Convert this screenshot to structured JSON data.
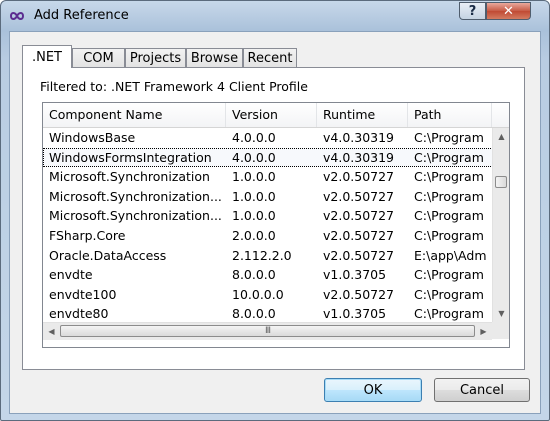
{
  "window": {
    "title": "Add Reference",
    "help_label": "?",
    "close_label": "✕"
  },
  "tabs": [
    {
      "label": ".NET",
      "active": true
    },
    {
      "label": "COM",
      "active": false
    },
    {
      "label": "Projects",
      "active": false
    },
    {
      "label": "Browse",
      "active": false
    },
    {
      "label": "Recent",
      "active": false
    }
  ],
  "filter_label": "Filtered to: .NET Framework 4 Client Profile",
  "columns": [
    "Component Name",
    "Version",
    "Runtime",
    "Path"
  ],
  "rows": [
    {
      "name": "WindowsBase",
      "version": "4.0.0.0",
      "runtime": "v4.0.30319",
      "path": "C:\\Program",
      "selected": false
    },
    {
      "name": "WindowsFormsIntegration",
      "version": "4.0.0.0",
      "runtime": "v4.0.30319",
      "path": "C:\\Program",
      "selected": true
    },
    {
      "name": "Microsoft.Synchronization",
      "version": "1.0.0.0",
      "runtime": "v2.0.50727",
      "path": "C:\\Program",
      "selected": false
    },
    {
      "name": "Microsoft.Synchronization...",
      "version": "1.0.0.0",
      "runtime": "v2.0.50727",
      "path": "C:\\Program",
      "selected": false
    },
    {
      "name": "Microsoft.Synchronization...",
      "version": "1.0.0.0",
      "runtime": "v2.0.50727",
      "path": "C:\\Program",
      "selected": false
    },
    {
      "name": "FSharp.Core",
      "version": "2.0.0.0",
      "runtime": "v2.0.50727",
      "path": "C:\\Program",
      "selected": false
    },
    {
      "name": "Oracle.DataAccess",
      "version": "2.112.2.0",
      "runtime": "v2.0.50727",
      "path": "E:\\app\\Adm",
      "selected": false
    },
    {
      "name": "envdte",
      "version": "8.0.0.0",
      "runtime": "v1.0.3705",
      "path": "C:\\Program",
      "selected": false
    },
    {
      "name": "envdte100",
      "version": "10.0.0.0",
      "runtime": "v2.0.50727",
      "path": "C:\\Program",
      "selected": false
    },
    {
      "name": "envdte80",
      "version": "8.0.0.0",
      "runtime": "v1.0.3705",
      "path": "C:\\Program",
      "selected": false
    }
  ],
  "scroll_grip": "III",
  "buttons": {
    "ok": "OK",
    "cancel": "Cancel"
  },
  "icons": {
    "app": "infinity-icon",
    "help": "help-icon",
    "close": "close-icon"
  }
}
